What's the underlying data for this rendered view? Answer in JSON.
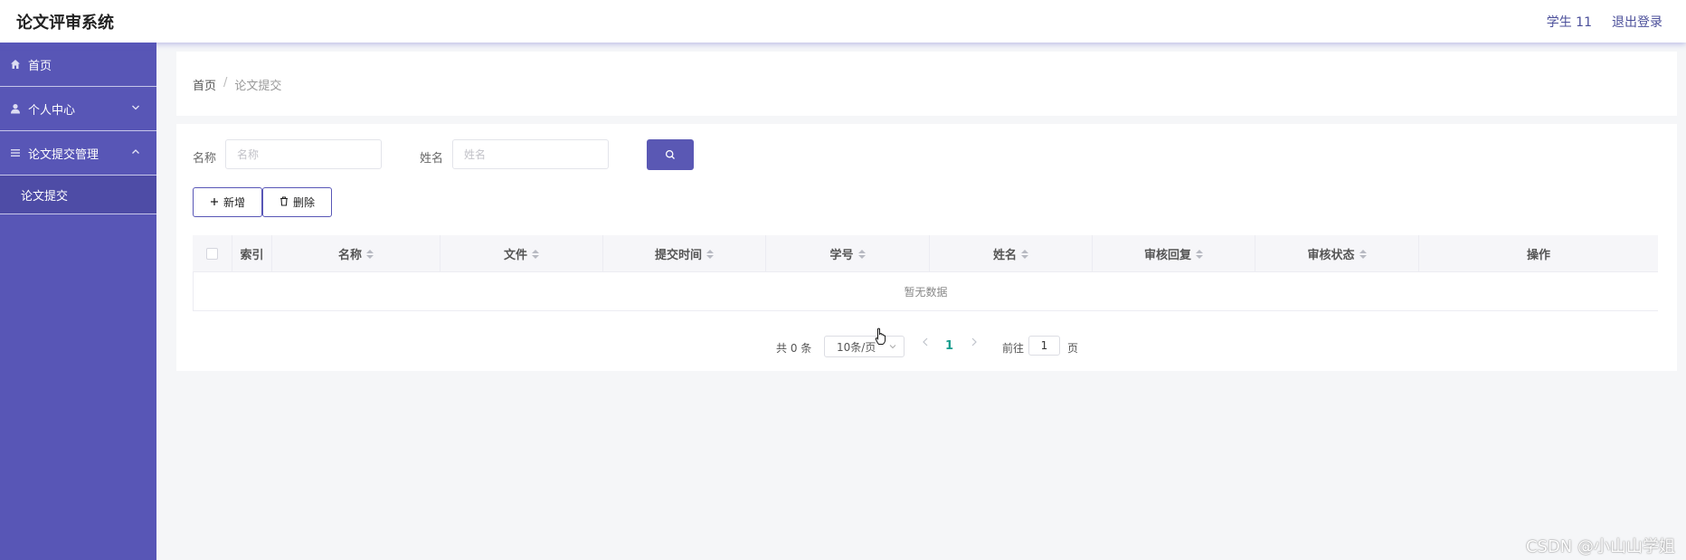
{
  "header": {
    "title": "论文评审系统",
    "user": "学生 11",
    "logout": "退出登录"
  },
  "sidebar": {
    "items": [
      {
        "label": "首页",
        "icon": "home-icon"
      },
      {
        "label": "个人中心",
        "icon": "user-icon"
      },
      {
        "label": "论文提交管理",
        "icon": "menu-icon"
      }
    ],
    "sub_items": [
      {
        "label": "论文提交"
      }
    ]
  },
  "breadcrumb": {
    "home": "首页",
    "separator": "/",
    "current": "论文提交"
  },
  "search": {
    "name_label": "名称",
    "name_placeholder": "名称",
    "name_value": "",
    "person_label": "姓名",
    "person_placeholder": "姓名",
    "person_value": ""
  },
  "actions": {
    "add": "新增",
    "delete": "删除"
  },
  "table": {
    "columns": [
      {
        "label": "索引",
        "sortable": false
      },
      {
        "label": "名称",
        "sortable": true
      },
      {
        "label": "文件",
        "sortable": true
      },
      {
        "label": "提交时间",
        "sortable": true
      },
      {
        "label": "学号",
        "sortable": true
      },
      {
        "label": "姓名",
        "sortable": true
      },
      {
        "label": "审核回复",
        "sortable": true
      },
      {
        "label": "审核状态",
        "sortable": true
      },
      {
        "label": "操作",
        "sortable": false
      }
    ],
    "empty_text": "暂无数据"
  },
  "pagination": {
    "total": "共 0 条",
    "page_size": "10条/页",
    "current_page": "1",
    "goto_label": "前往",
    "goto_value": "1",
    "page_suffix": "页"
  },
  "watermark": "CSDN @小山山学姐",
  "colors": {
    "sidebar": "#5856b6",
    "accent": "#5a58b4",
    "active_page": "#1a9e8f"
  }
}
